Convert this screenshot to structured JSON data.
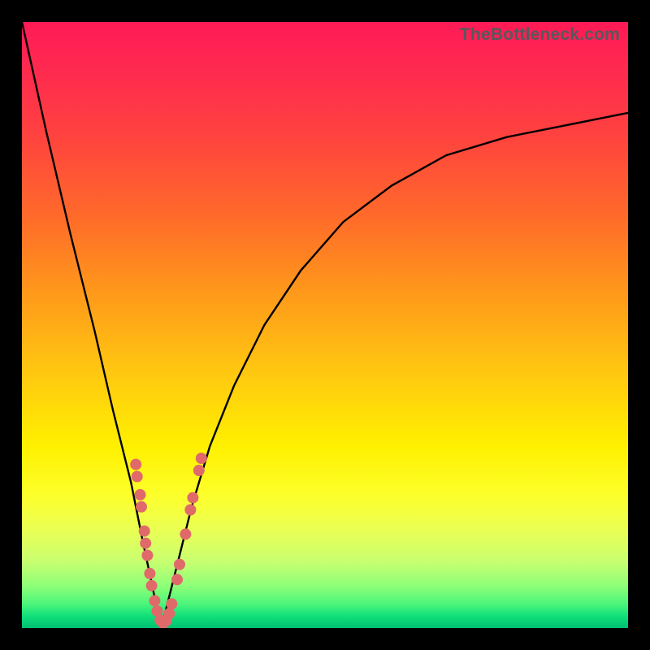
{
  "watermark": "TheBottleneck.com",
  "chart_data": {
    "type": "line",
    "title": "",
    "xlabel": "",
    "ylabel": "",
    "xlim": [
      0,
      100
    ],
    "ylim": [
      0,
      100
    ],
    "notch_x_percent": 23,
    "series": [
      {
        "name": "bottleneck-curve",
        "x": [
          0,
          4,
          8,
          12,
          15,
          18,
          20,
          21.5,
          22.5,
          23,
          23.5,
          24.5,
          26,
          28,
          31,
          35,
          40,
          46,
          53,
          61,
          70,
          80,
          90,
          100
        ],
        "y": [
          100,
          82,
          65,
          49,
          36,
          24,
          14,
          7,
          2,
          0,
          2,
          6,
          12,
          20,
          30,
          40,
          50,
          59,
          67,
          73,
          78,
          81,
          83,
          85
        ]
      }
    ],
    "markers": {
      "name": "left-branch-dots",
      "color": "#e06a6a",
      "points": [
        {
          "x": 18.8,
          "y": 27
        },
        {
          "x": 19.0,
          "y": 25
        },
        {
          "x": 19.5,
          "y": 22
        },
        {
          "x": 19.7,
          "y": 20
        },
        {
          "x": 20.2,
          "y": 16
        },
        {
          "x": 20.4,
          "y": 14
        },
        {
          "x": 20.7,
          "y": 12
        },
        {
          "x": 21.1,
          "y": 9
        },
        {
          "x": 21.4,
          "y": 7
        },
        {
          "x": 21.9,
          "y": 4.5
        },
        {
          "x": 22.3,
          "y": 2.8
        },
        {
          "x": 22.8,
          "y": 1.3
        },
        {
          "x": 23.3,
          "y": 0.8
        },
        {
          "x": 23.8,
          "y": 1.2
        },
        {
          "x": 24.3,
          "y": 2.4
        },
        {
          "x": 24.7,
          "y": 4.0
        },
        {
          "x": 25.6,
          "y": 8.0
        },
        {
          "x": 26.0,
          "y": 10.5
        },
        {
          "x": 27.0,
          "y": 15.5
        },
        {
          "x": 27.8,
          "y": 19.5
        },
        {
          "x": 28.2,
          "y": 21.5
        },
        {
          "x": 29.2,
          "y": 26.0
        },
        {
          "x": 29.6,
          "y": 28.0
        }
      ]
    },
    "gradient_stops": [
      {
        "pos": 0,
        "color": "#ff1a56"
      },
      {
        "pos": 18,
        "color": "#ff4040"
      },
      {
        "pos": 45,
        "color": "#ff9a1a"
      },
      {
        "pos": 70,
        "color": "#fff000"
      },
      {
        "pos": 89,
        "color": "#c8ff70"
      },
      {
        "pos": 100,
        "color": "#00c072"
      }
    ]
  }
}
